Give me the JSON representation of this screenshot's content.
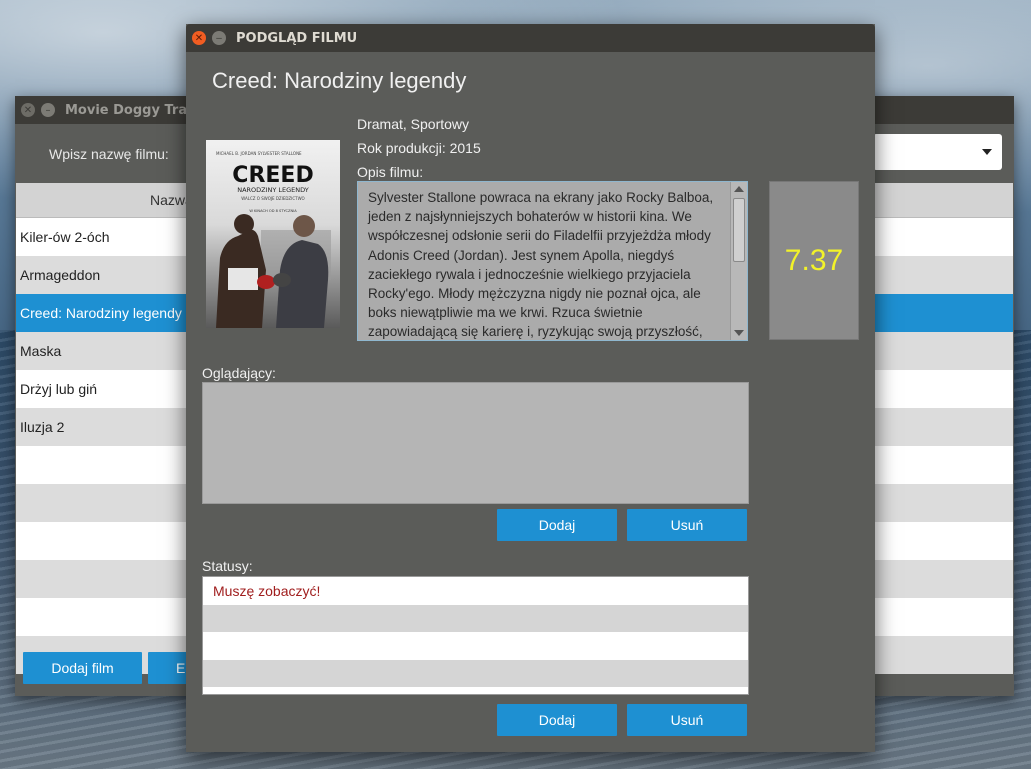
{
  "back_window": {
    "title": "Movie Doggy Tra",
    "search_label": "Wpisz nazwę filmu:",
    "table_header": "Nazwa",
    "rows": [
      "Kiler-ów 2-óch",
      "Armageddon",
      "Creed: Narodziny legendy",
      "Maska",
      "Drżyj lub giń",
      "Iluzja 2",
      "",
      "",
      "",
      "",
      "",
      ""
    ],
    "selected_index": 2,
    "buttons": {
      "add_movie": "Dodaj film",
      "edit": "Ed"
    }
  },
  "dialog": {
    "title": "PODGLĄD FILMU",
    "movie_title": "Creed: Narodziny legendy",
    "genres": "Dramat, Sportowy",
    "year_label": "Rok produkcji: 2015",
    "description_label": "Opis filmu:",
    "description": "Sylvester Stallone powraca na ekrany jako Rocky Balboa, jeden z najsłynniejszych bohaterów w historii kina. We współczesnej odsłonie serii do Filadelfii przyjeżdża młody Adonis Creed (Jordan). Jest synem Apolla, niegdyś zaciekłego rywala i jednocześnie wielkiego przyjaciela Rocky'ego. Młody mężczyzna nigdy nie poznał ojca, ale boks niewątpliwie ma we krwi. Rzuca świetnie zapowiadającą się karierę i, ryzykując swoją przyszłość,",
    "rating": "7.37",
    "rating_color": "#f2f22a",
    "viewers_label": "Oglądający:",
    "statuses_label": "Statusy:",
    "statuses": [
      "Muszę zobaczyć!",
      "",
      "",
      ""
    ],
    "poster": {
      "top_names": "MICHAEL B. JORDAN     SYLVESTER STALLONE",
      "title": "CREED",
      "subtitle": "NARODZINY LEGENDY",
      "tagline": "WALCZ O SWOJE DZIEDZICTWO",
      "date": "W KINACH OD 8 STYCZNIA"
    },
    "buttons": {
      "viewers_add": "Dodaj",
      "viewers_remove": "Usuń",
      "status_add": "Dodaj",
      "status_remove": "Usuń"
    }
  }
}
